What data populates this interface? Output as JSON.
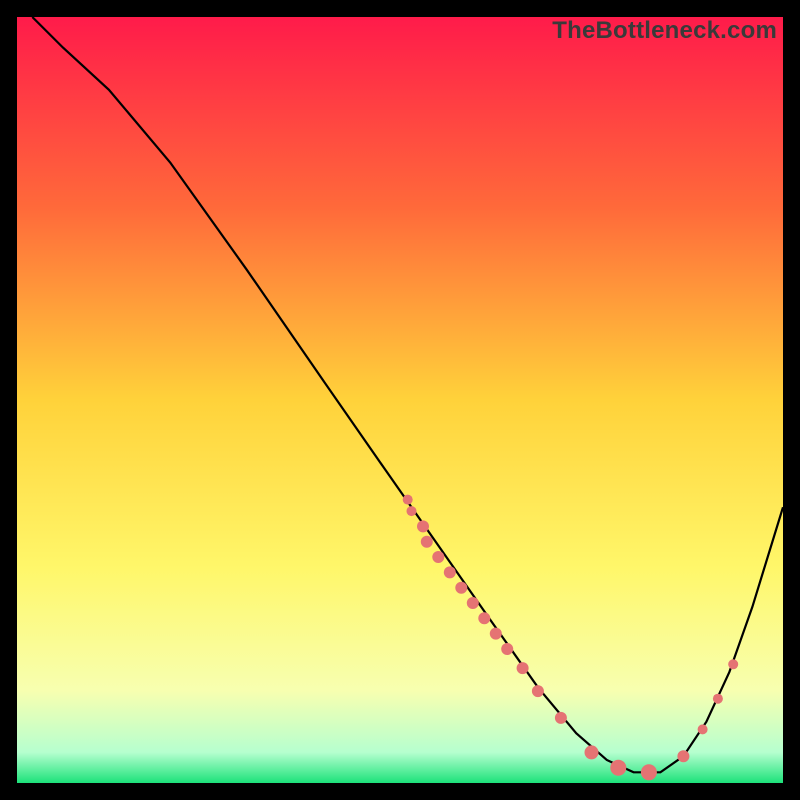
{
  "watermark": "TheBottleneck.com",
  "chart_data": {
    "type": "line",
    "title": "",
    "xlabel": "",
    "ylabel": "",
    "xlim": [
      0,
      100
    ],
    "ylim": [
      0,
      100
    ],
    "background_gradient": {
      "stops": [
        {
          "offset": 0,
          "color": "#ff1b4a"
        },
        {
          "offset": 25,
          "color": "#ff6a3a"
        },
        {
          "offset": 50,
          "color": "#ffd23a"
        },
        {
          "offset": 72,
          "color": "#fff76a"
        },
        {
          "offset": 88,
          "color": "#f7ffb0"
        },
        {
          "offset": 96,
          "color": "#b6ffcf"
        },
        {
          "offset": 100,
          "color": "#1de27a"
        }
      ]
    },
    "curve": [
      {
        "x": 2.0,
        "y": 100.0
      },
      {
        "x": 6.0,
        "y": 96.0
      },
      {
        "x": 12.0,
        "y": 90.5
      },
      {
        "x": 20.0,
        "y": 81.0
      },
      {
        "x": 30.0,
        "y": 67.0
      },
      {
        "x": 40.0,
        "y": 52.5
      },
      {
        "x": 48.0,
        "y": 41.0
      },
      {
        "x": 55.0,
        "y": 31.0
      },
      {
        "x": 62.0,
        "y": 21.0
      },
      {
        "x": 68.0,
        "y": 12.5
      },
      {
        "x": 73.0,
        "y": 6.5
      },
      {
        "x": 77.0,
        "y": 3.0
      },
      {
        "x": 80.5,
        "y": 1.4
      },
      {
        "x": 84.0,
        "y": 1.4
      },
      {
        "x": 87.0,
        "y": 3.5
      },
      {
        "x": 90.0,
        "y": 8.0
      },
      {
        "x": 93.0,
        "y": 14.5
      },
      {
        "x": 96.0,
        "y": 23.0
      },
      {
        "x": 100.0,
        "y": 36.0
      }
    ],
    "scatter": [
      {
        "x": 51.0,
        "y": 37.0,
        "r": 5
      },
      {
        "x": 51.5,
        "y": 35.5,
        "r": 5
      },
      {
        "x": 53.0,
        "y": 33.5,
        "r": 6
      },
      {
        "x": 53.5,
        "y": 31.5,
        "r": 6
      },
      {
        "x": 55.0,
        "y": 29.5,
        "r": 6
      },
      {
        "x": 56.5,
        "y": 27.5,
        "r": 6
      },
      {
        "x": 58.0,
        "y": 25.5,
        "r": 6
      },
      {
        "x": 59.5,
        "y": 23.5,
        "r": 6
      },
      {
        "x": 61.0,
        "y": 21.5,
        "r": 6
      },
      {
        "x": 62.5,
        "y": 19.5,
        "r": 6
      },
      {
        "x": 64.0,
        "y": 17.5,
        "r": 6
      },
      {
        "x": 66.0,
        "y": 15.0,
        "r": 6
      },
      {
        "x": 68.0,
        "y": 12.0,
        "r": 6
      },
      {
        "x": 71.0,
        "y": 8.5,
        "r": 6
      },
      {
        "x": 75.0,
        "y": 4.0,
        "r": 7
      },
      {
        "x": 78.5,
        "y": 2.0,
        "r": 8
      },
      {
        "x": 82.5,
        "y": 1.4,
        "r": 8
      },
      {
        "x": 87.0,
        "y": 3.5,
        "r": 6
      },
      {
        "x": 89.5,
        "y": 7.0,
        "r": 5
      },
      {
        "x": 91.5,
        "y": 11.0,
        "r": 5
      },
      {
        "x": 93.5,
        "y": 15.5,
        "r": 5
      }
    ],
    "scatter_color": "#e57373",
    "curve_color": "#000000"
  }
}
